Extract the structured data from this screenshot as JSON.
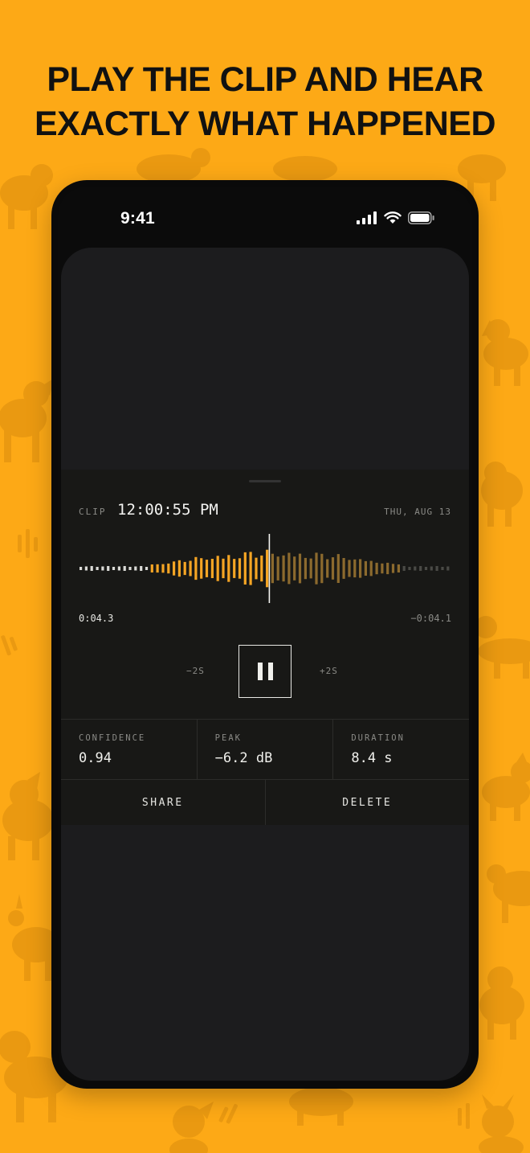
{
  "headline": {
    "line1": "PLAY THE CLIP AND HEAR",
    "line2": "EXACTLY WHAT HAPPENED"
  },
  "status_bar": {
    "time": "9:41",
    "icons": [
      "cellular-signal-icon",
      "wifi-icon",
      "battery-icon"
    ]
  },
  "clip": {
    "label": "CLIP",
    "time": "12:00:55 PM",
    "date": "THU, AUG 13",
    "elapsed": "0:04.3",
    "remaining": "−0:04.1",
    "playhead_fraction": 0.51
  },
  "controls": {
    "skip_back": "−2S",
    "skip_forward": "+2S",
    "pause_icon": "pause-icon"
  },
  "stats": [
    {
      "label": "CONFIDENCE",
      "value": "0.94"
    },
    {
      "label": "PEAK",
      "value": "−6.2 dB"
    },
    {
      "label": "DURATION",
      "value": "8.4 s"
    }
  ],
  "actions": {
    "share": "SHARE",
    "delete": "DELETE"
  },
  "colors": {
    "background": "#FDA916",
    "waveform_played": "#F5A524",
    "waveform_unplayed_loud": "#8C6A2E",
    "waveform_quiet": "#DADAD6",
    "waveform_quiet_tail": "#4A4A46",
    "screen": "#1C1C1E",
    "sheet": "#181816"
  }
}
